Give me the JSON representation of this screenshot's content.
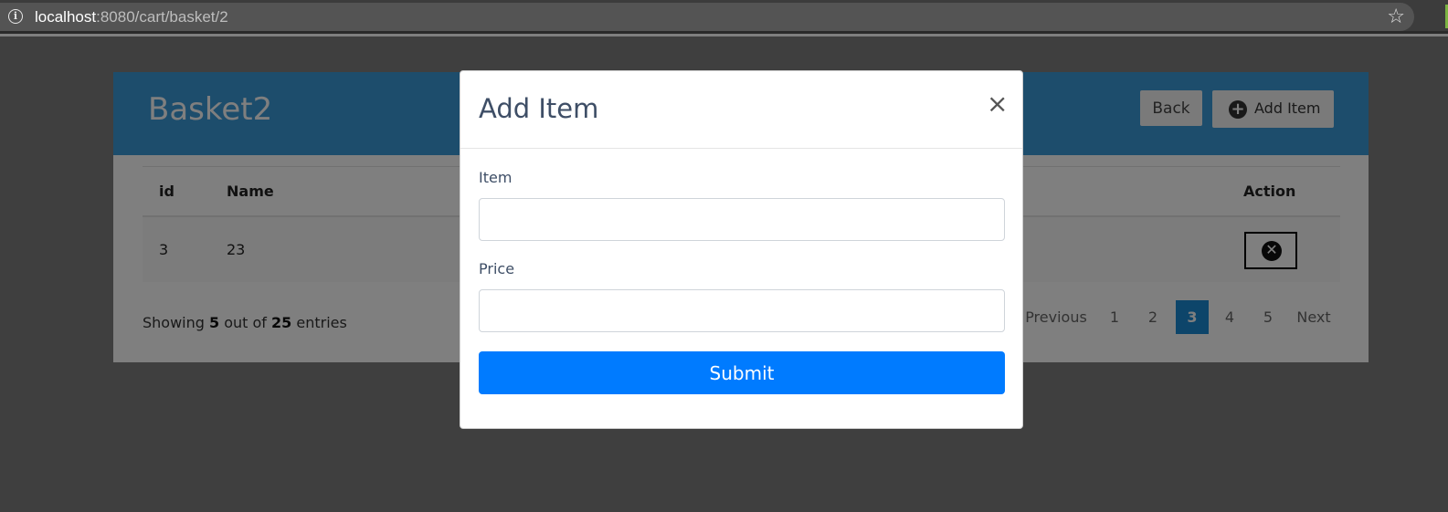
{
  "browser": {
    "url_host": "localhost",
    "url_path": ":8080/cart/basket/2",
    "info_icon": "i",
    "star_icon": "☆"
  },
  "page": {
    "title": "Basket2",
    "back_label": "Back",
    "add_item_label": "Add Item",
    "table": {
      "headers": [
        "id",
        "Name",
        "Action"
      ],
      "rows": [
        {
          "id": "3",
          "name": "23"
        }
      ]
    },
    "showing": {
      "prefix": "Showing ",
      "shown": "5",
      "middle": " out of ",
      "total": "25",
      "suffix": " entries"
    },
    "pagination": {
      "previous": "Previous",
      "pages": [
        "1",
        "2",
        "3",
        "4",
        "5"
      ],
      "active": "3",
      "next": "Next"
    }
  },
  "modal": {
    "title": "Add Item",
    "close_icon": "×",
    "item_label": "Item",
    "item_value": "",
    "price_label": "Price",
    "price_value": "",
    "submit_label": "Submit"
  },
  "colors": {
    "header_blue": "#3b9ad9",
    "submit_blue": "#007bff",
    "active_page": "#1a8ad4"
  }
}
